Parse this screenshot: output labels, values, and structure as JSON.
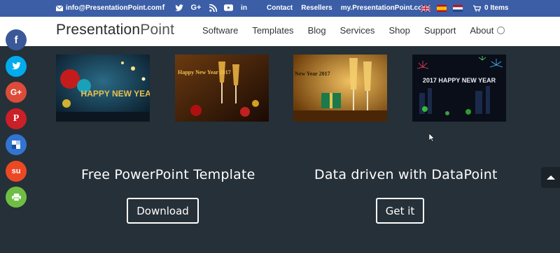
{
  "topbar": {
    "email": "info@PresentationPoint.com",
    "links": [
      "Contact",
      "Resellers",
      "my.PresentationPoint.com"
    ],
    "cart_label": "0 Items"
  },
  "header": {
    "logo_part1": "Presentation",
    "logo_part2": "Point",
    "nav": [
      "Software",
      "Templates",
      "Blog",
      "Services",
      "Shop",
      "Support",
      "About"
    ]
  },
  "share": [
    {
      "icon": "facebook-icon",
      "glyph": "f",
      "color": "#3b5998"
    },
    {
      "icon": "twitter-icon",
      "glyph": "🐦",
      "color": "#00aced"
    },
    {
      "icon": "google-plus-icon",
      "glyph": "G+",
      "color": "#dd4b39"
    },
    {
      "icon": "pinterest-icon",
      "glyph": "P",
      "color": "#cb2027"
    },
    {
      "icon": "delicious-icon",
      "glyph": "",
      "color": "#3274d1"
    },
    {
      "icon": "stumbleupon-icon",
      "glyph": "su",
      "color": "#eb4924"
    },
    {
      "icon": "print-icon",
      "glyph": "⎙",
      "color": "#6fbe44"
    }
  ],
  "thumbnails": [
    {
      "caption": "HAPPY NEW YEAR"
    },
    {
      "caption": "Happy New Year 2017"
    },
    {
      "caption": "New Year 2017"
    },
    {
      "caption": "2017 HAPPY NEW YEAR"
    }
  ],
  "cta_left": {
    "title": "Free PowerPoint Template",
    "button": "Download"
  },
  "cta_right": {
    "title": "Data driven with DataPoint",
    "button": "Get it"
  },
  "colors": {
    "topbar_bg": "#3b5ea6",
    "page_bg": "#263038"
  }
}
